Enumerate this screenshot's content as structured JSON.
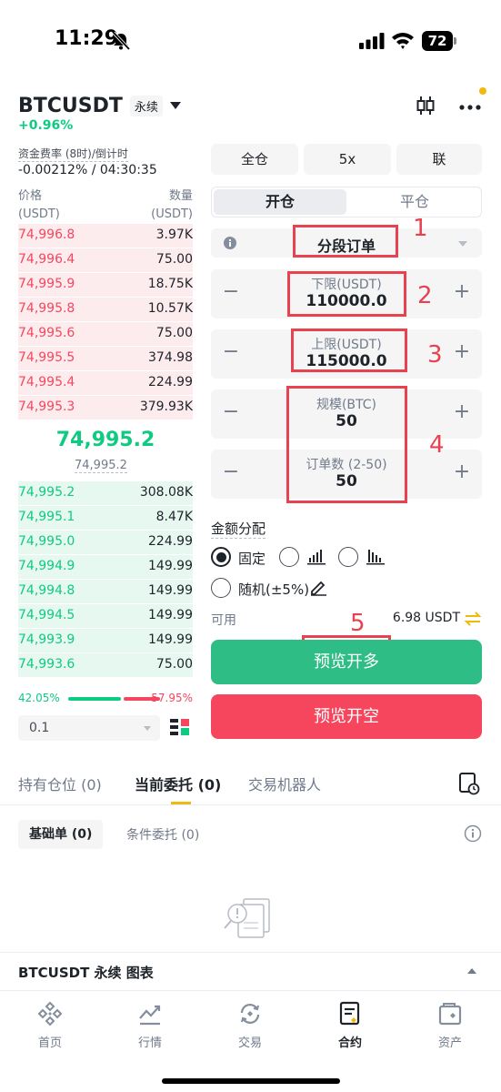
{
  "status": {
    "time": "11:29",
    "battery": "72"
  },
  "header": {
    "pair": "BTCUSDT",
    "perp": "永续",
    "change": "+0.96%"
  },
  "funding": {
    "label": "资金费率 (8时)/倒计时",
    "value": "-0.00212% / 04:30:35"
  },
  "orderbook": {
    "price_label": "价格",
    "price_unit": "(USDT)",
    "qty_label": "数量",
    "qty_unit": "(USDT)",
    "asks": [
      {
        "price": "74,996.8",
        "qty": "3.97K"
      },
      {
        "price": "74,996.4",
        "qty": "75.00"
      },
      {
        "price": "74,995.9",
        "qty": "18.75K"
      },
      {
        "price": "74,995.8",
        "qty": "10.57K"
      },
      {
        "price": "74,995.6",
        "qty": "75.00"
      },
      {
        "price": "74,995.5",
        "qty": "374.98"
      },
      {
        "price": "74,995.4",
        "qty": "224.99"
      },
      {
        "price": "74,995.3",
        "qty": "379.93K"
      }
    ],
    "mid_price": "74,995.2",
    "mark_price": "74,995.2",
    "bids": [
      {
        "price": "74,995.2",
        "qty": "308.08K"
      },
      {
        "price": "74,995.1",
        "qty": "8.47K"
      },
      {
        "price": "74,995.0",
        "qty": "224.99"
      },
      {
        "price": "74,994.9",
        "qty": "149.99"
      },
      {
        "price": "74,994.8",
        "qty": "149.99"
      },
      {
        "price": "74,994.5",
        "qty": "149.99"
      },
      {
        "price": "74,993.9",
        "qty": "149.99"
      },
      {
        "price": "74,993.6",
        "qty": "75.00"
      }
    ],
    "buy_ratio": "42.05%",
    "sell_ratio": "57.95%",
    "precision": "0.1"
  },
  "panel": {
    "margin_mode": "全仓",
    "leverage": "5x",
    "position_mode": "联",
    "open_tab": "开仓",
    "close_tab": "平仓",
    "order_type": "分段订单",
    "lower_label": "下限(USDT)",
    "lower_value": "110000.0",
    "upper_label": "上限(USDT)",
    "upper_value": "115000.0",
    "size_label": "规模(BTC)",
    "size_value": "50",
    "count_label": "订单数 (2-50)",
    "count_value": "50",
    "alloc_label": "金额分配",
    "alloc_fixed": "固定",
    "alloc_random": "随机(±5%)",
    "available_label": "可用",
    "available_value": "6.98 USDT",
    "btn_long": "预览开多",
    "btn_short": "预览开空"
  },
  "annotations": [
    "1",
    "2",
    "3",
    "4",
    "5"
  ],
  "tabs": {
    "positions": "持有仓位 (0)",
    "open_orders": "当前委托 (0)",
    "bots": "交易机器人"
  },
  "subtabs": {
    "basic": "基础单 (0)",
    "conditional": "条件委托 (0)"
  },
  "chart_bar": {
    "title": "BTCUSDT 永续 图表"
  },
  "nav": [
    "首页",
    "行情",
    "交易",
    "合约",
    "资产"
  ],
  "colors": {
    "green": "#0ecb81",
    "red": "#f6465d",
    "accent": "#f0b90b",
    "annotation": "#e8414f"
  }
}
